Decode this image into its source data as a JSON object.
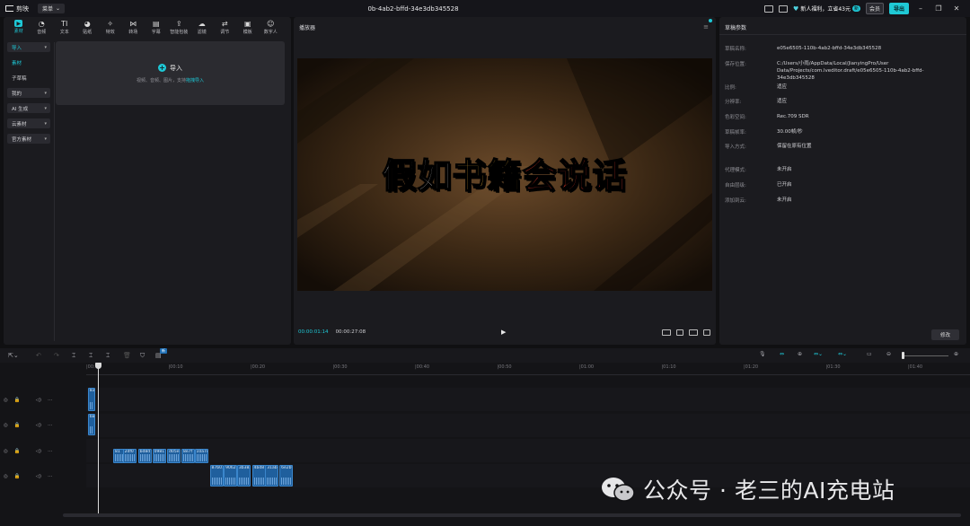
{
  "titlebar": {
    "app_name": "剪映",
    "menu_label": "菜单",
    "doc_title": "0b-4ab2-bffd-34e3db345528",
    "promo_text": "新人福利，立省43元",
    "promo_badge": "新",
    "vip_label": "会员",
    "export_label": "导出"
  },
  "toolbar": {
    "tools": [
      {
        "label": "素材",
        "icon": "media-icon"
      },
      {
        "label": "音频",
        "icon": "audio-icon"
      },
      {
        "label": "文本",
        "icon": "text-icon"
      },
      {
        "label": "贴纸",
        "icon": "sticker-icon"
      },
      {
        "label": "特效",
        "icon": "effects-icon"
      },
      {
        "label": "转场",
        "icon": "transition-icon"
      },
      {
        "label": "字幕",
        "icon": "caption-icon"
      },
      {
        "label": "智能包装",
        "icon": "smart-pack-icon"
      },
      {
        "label": "滤镜",
        "icon": "filter-icon"
      },
      {
        "label": "调节",
        "icon": "adjust-icon"
      },
      {
        "label": "模板",
        "icon": "template-icon"
      },
      {
        "label": "数字人",
        "icon": "avatar-icon"
      }
    ]
  },
  "sidenav": {
    "items": [
      "导入",
      "素材",
      "子草稿",
      "我的",
      "AI 生成",
      "云素材",
      "官方素材"
    ]
  },
  "import_card": {
    "label": "导入",
    "hint": "视频、音频、图片，支持",
    "hint_link": "拖拽导入"
  },
  "player": {
    "title": "播放器",
    "video_title_a": "假如",
    "video_title_b": "书籍",
    "video_title_c": "会说话",
    "current_time": "00:00:01:14",
    "total_time": "00:00:27:08"
  },
  "draft": {
    "title": "草稿参数",
    "props": [
      {
        "k": "草稿名称:",
        "v": "e05e6505-110b-4ab2-bffd-34e3db345528"
      },
      {
        "k": "保存位置:",
        "v": "C:/Users/小雨/AppData/Local/JianyingPro/User Data/Projects/com.lveditor.draft/e05e6505-110b-4ab2-bffd-34e3db345528"
      },
      {
        "k": "比例:",
        "v": "适应"
      },
      {
        "k": "分辨率:",
        "v": "适应"
      },
      {
        "k": "色彩空间:",
        "v": "Rec.709 SDR"
      },
      {
        "k": "草稿帧率:",
        "v": "30.00帧/秒"
      },
      {
        "k": "导入方式:",
        "v": "保留在原有位置"
      },
      {
        "k": "代理模式:",
        "v": "未开启"
      },
      {
        "k": "自由层级:",
        "v": "已开启"
      },
      {
        "k": "添加到云:",
        "v": "未开启"
      }
    ],
    "modify_label": "修改"
  },
  "timeline": {
    "tag": "新",
    "ticks": [
      "00:00",
      "00:10",
      "00:20",
      "00:30",
      "00:40",
      "00:50",
      "01:00",
      "01:10",
      "01:20",
      "01:30",
      "01:40"
    ],
    "clips": [
      {
        "row": 0,
        "start": 0.2,
        "label": "83"
      },
      {
        "row": 1,
        "start": 0.2,
        "label": "ba"
      },
      {
        "row": 2,
        "start": 3.28,
        "label": "81"
      },
      {
        "row": 2,
        "start": 4.44,
        "label": "2df0"
      },
      {
        "row": 2,
        "start": 6.3,
        "label": "bd8d"
      },
      {
        "row": 2,
        "start": 8.05,
        "label": "0981"
      },
      {
        "row": 2,
        "start": 9.85,
        "label": "d05e"
      },
      {
        "row": 2,
        "start": 11.58,
        "label": "8e7f"
      },
      {
        "row": 2,
        "start": 13.17,
        "label": "10a7c"
      },
      {
        "row": 3,
        "start": 15.03,
        "label": "87b01"
      },
      {
        "row": 3,
        "start": 16.74,
        "label": "9062"
      },
      {
        "row": 3,
        "start": 18.35,
        "label": "3b382"
      },
      {
        "row": 3,
        "start": 20.18,
        "label": "4bd8"
      },
      {
        "row": 3,
        "start": 21.78,
        "label": "31ab7"
      },
      {
        "row": 3,
        "start": 23.51,
        "label": "6e2b9"
      }
    ]
  },
  "watermark": {
    "text": "公众号 · 老三的AI充电站"
  }
}
